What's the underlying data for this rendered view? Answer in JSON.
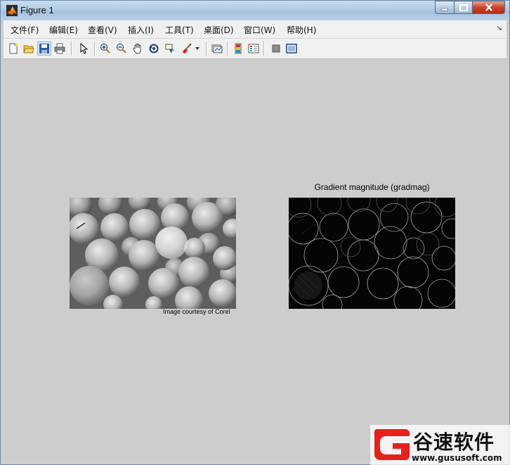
{
  "window": {
    "title": "Figure 1"
  },
  "menu": [
    "文件(F)",
    "编辑(E)",
    "查看(V)",
    "插入(I)",
    "工具(T)",
    "桌面(D)",
    "窗口(W)",
    "帮助(H)"
  ],
  "toolbar": {
    "buttons": [
      "new-figure",
      "open-file",
      "save-figure",
      "print-figure",
      "edit-plot",
      "zoom-in",
      "zoom-out",
      "pan",
      "rotate-3d",
      "data-cursor",
      "brush",
      "link-plot",
      "insert-colorbar",
      "insert-legend",
      "hide-plot-tools",
      "show-plot-tools"
    ]
  },
  "figure": {
    "left_image_caption": "Image courtesy of Corel",
    "right_title": "Gradient magnitude (gradmag)"
  },
  "watermark": {
    "text": "谷速软件",
    "url": "www.gususoft.com"
  },
  "colors": {
    "titlebar": "#b9d0e8",
    "figure_bg": "#cdcdcd",
    "toolbar_bg": "#f0f0f0",
    "watermark_red": "#e8201c"
  }
}
